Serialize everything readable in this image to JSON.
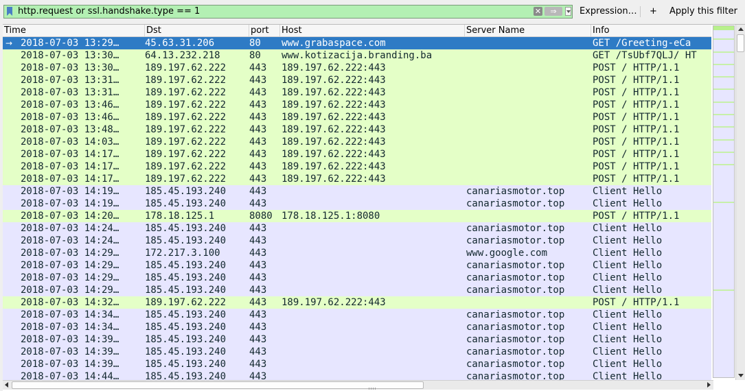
{
  "toolbar": {
    "filter_value": "http.request or ssl.handshake.type == 1",
    "clear_icon": "close-icon",
    "apply_icon": "arrow-right-icon",
    "expression_label": "Expression…",
    "plus_label": "+",
    "apply_label": "Apply this filter"
  },
  "columns": {
    "time": "Time",
    "dst": "Dst",
    "port": "port",
    "host": "Host",
    "server_name": "Server Name",
    "info": "Info"
  },
  "colors": {
    "http_row": "#e4ffc7",
    "tls_row": "#e7e6ff",
    "selected_row": "#2e7bc5",
    "filter_valid": "#b3f0b3"
  },
  "packets": [
    {
      "time": "2018-07-03 13:29…",
      "dst": "45.63.31.206",
      "port": "80",
      "host": "www.grabaspace.com",
      "sni": "",
      "info": "GET /Greeting-eCa",
      "kind": "http",
      "selected": true
    },
    {
      "time": "2018-07-03 13:30…",
      "dst": "64.13.232.218",
      "port": "80",
      "host": "www.kotizacija.branding.ba",
      "sni": "",
      "info": "GET /TsUbf7QLJ/ HT",
      "kind": "http"
    },
    {
      "time": "2018-07-03 13:30…",
      "dst": "189.197.62.222",
      "port": "443",
      "host": "189.197.62.222:443",
      "sni": "",
      "info": "POST / HTTP/1.1",
      "kind": "http"
    },
    {
      "time": "2018-07-03 13:31…",
      "dst": "189.197.62.222",
      "port": "443",
      "host": "189.197.62.222:443",
      "sni": "",
      "info": "POST / HTTP/1.1",
      "kind": "http"
    },
    {
      "time": "2018-07-03 13:31…",
      "dst": "189.197.62.222",
      "port": "443",
      "host": "189.197.62.222:443",
      "sni": "",
      "info": "POST / HTTP/1.1",
      "kind": "http"
    },
    {
      "time": "2018-07-03 13:46…",
      "dst": "189.197.62.222",
      "port": "443",
      "host": "189.197.62.222:443",
      "sni": "",
      "info": "POST / HTTP/1.1",
      "kind": "http"
    },
    {
      "time": "2018-07-03 13:46…",
      "dst": "189.197.62.222",
      "port": "443",
      "host": "189.197.62.222:443",
      "sni": "",
      "info": "POST / HTTP/1.1",
      "kind": "http"
    },
    {
      "time": "2018-07-03 13:48…",
      "dst": "189.197.62.222",
      "port": "443",
      "host": "189.197.62.222:443",
      "sni": "",
      "info": "POST / HTTP/1.1",
      "kind": "http"
    },
    {
      "time": "2018-07-03 14:03…",
      "dst": "189.197.62.222",
      "port": "443",
      "host": "189.197.62.222:443",
      "sni": "",
      "info": "POST / HTTP/1.1",
      "kind": "http"
    },
    {
      "time": "2018-07-03 14:17…",
      "dst": "189.197.62.222",
      "port": "443",
      "host": "189.197.62.222:443",
      "sni": "",
      "info": "POST / HTTP/1.1",
      "kind": "http"
    },
    {
      "time": "2018-07-03 14:17…",
      "dst": "189.197.62.222",
      "port": "443",
      "host": "189.197.62.222:443",
      "sni": "",
      "info": "POST / HTTP/1.1",
      "kind": "http"
    },
    {
      "time": "2018-07-03 14:17…",
      "dst": "189.197.62.222",
      "port": "443",
      "host": "189.197.62.222:443",
      "sni": "",
      "info": "POST / HTTP/1.1",
      "kind": "http"
    },
    {
      "time": "2018-07-03 14:19…",
      "dst": "185.45.193.240",
      "port": "443",
      "host": "",
      "sni": "canariasmotor.top",
      "info": "Client Hello",
      "kind": "tls"
    },
    {
      "time": "2018-07-03 14:19…",
      "dst": "185.45.193.240",
      "port": "443",
      "host": "",
      "sni": "canariasmotor.top",
      "info": "Client Hello",
      "kind": "tls"
    },
    {
      "time": "2018-07-03 14:20…",
      "dst": "178.18.125.1",
      "port": "8080",
      "host": "178.18.125.1:8080",
      "sni": "",
      "info": "POST / HTTP/1.1",
      "kind": "http"
    },
    {
      "time": "2018-07-03 14:24…",
      "dst": "185.45.193.240",
      "port": "443",
      "host": "",
      "sni": "canariasmotor.top",
      "info": "Client Hello",
      "kind": "tls"
    },
    {
      "time": "2018-07-03 14:24…",
      "dst": "185.45.193.240",
      "port": "443",
      "host": "",
      "sni": "canariasmotor.top",
      "info": "Client Hello",
      "kind": "tls"
    },
    {
      "time": "2018-07-03 14:29…",
      "dst": "172.217.3.100",
      "port": "443",
      "host": "",
      "sni": "www.google.com",
      "info": "Client Hello",
      "kind": "tls"
    },
    {
      "time": "2018-07-03 14:29…",
      "dst": "185.45.193.240",
      "port": "443",
      "host": "",
      "sni": "canariasmotor.top",
      "info": "Client Hello",
      "kind": "tls"
    },
    {
      "time": "2018-07-03 14:29…",
      "dst": "185.45.193.240",
      "port": "443",
      "host": "",
      "sni": "canariasmotor.top",
      "info": "Client Hello",
      "kind": "tls"
    },
    {
      "time": "2018-07-03 14:29…",
      "dst": "185.45.193.240",
      "port": "443",
      "host": "",
      "sni": "canariasmotor.top",
      "info": "Client Hello",
      "kind": "tls"
    },
    {
      "time": "2018-07-03 14:32…",
      "dst": "189.197.62.222",
      "port": "443",
      "host": "189.197.62.222:443",
      "sni": "",
      "info": "POST / HTTP/1.1",
      "kind": "http"
    },
    {
      "time": "2018-07-03 14:34…",
      "dst": "185.45.193.240",
      "port": "443",
      "host": "",
      "sni": "canariasmotor.top",
      "info": "Client Hello",
      "kind": "tls"
    },
    {
      "time": "2018-07-03 14:34…",
      "dst": "185.45.193.240",
      "port": "443",
      "host": "",
      "sni": "canariasmotor.top",
      "info": "Client Hello",
      "kind": "tls"
    },
    {
      "time": "2018-07-03 14:39…",
      "dst": "185.45.193.240",
      "port": "443",
      "host": "",
      "sni": "canariasmotor.top",
      "info": "Client Hello",
      "kind": "tls"
    },
    {
      "time": "2018-07-03 14:39…",
      "dst": "185.45.193.240",
      "port": "443",
      "host": "",
      "sni": "canariasmotor.top",
      "info": "Client Hello",
      "kind": "tls"
    },
    {
      "time": "2018-07-03 14:39…",
      "dst": "185.45.193.240",
      "port": "443",
      "host": "",
      "sni": "canariasmotor.top",
      "info": "Client Hello",
      "kind": "tls"
    },
    {
      "time": "2018-07-03 14:44…",
      "dst": "185.45.193.240",
      "port": "443",
      "host": "",
      "sni": "canariasmotor.top",
      "info": "Client Hello",
      "kind": "tls"
    }
  ]
}
